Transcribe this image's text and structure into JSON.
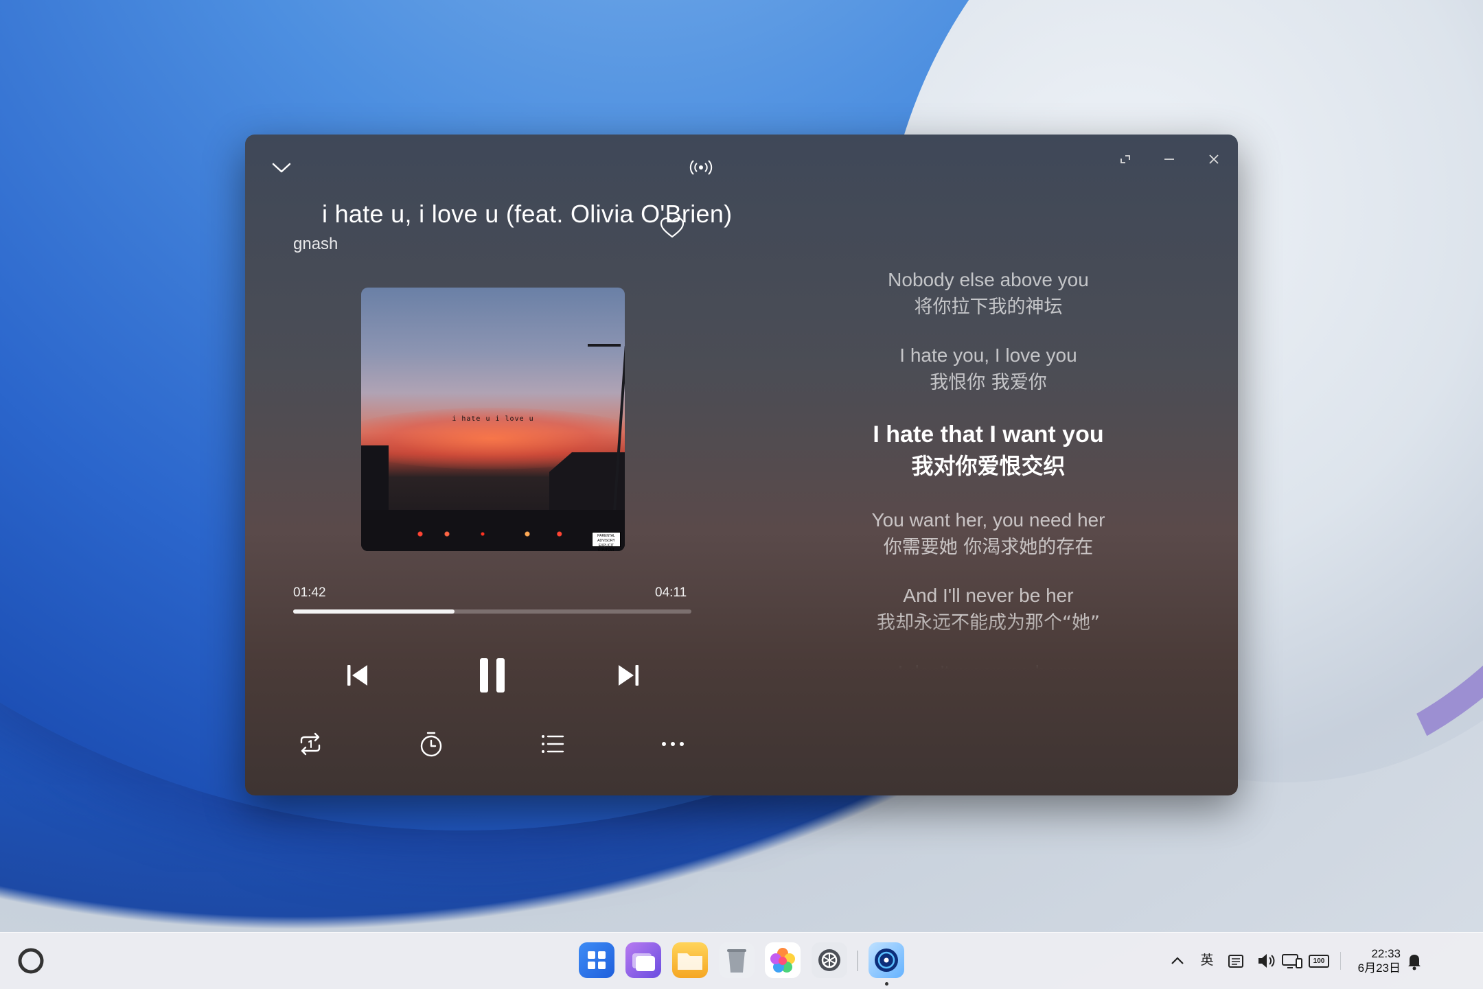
{
  "player": {
    "song_title": "i hate u, i love u (feat. Olivia O'Brien)",
    "artist": "gnash",
    "cover_text": "i hate u i love u",
    "advisory_text": "PARENTAL ADVISORY EXPLICIT CONTENT",
    "current_time": "01:42",
    "total_time": "04:11",
    "progress_fraction": 0.406
  },
  "lyrics": [
    {
      "en": "Nobody else above you",
      "zh": "将你拉下我的神坛",
      "active": false
    },
    {
      "en": "I hate you, I love you",
      "zh": "我恨你 我爱你",
      "active": false
    },
    {
      "en": "I hate that I want you",
      "zh": "我对你爱恨交织",
      "active": true
    },
    {
      "en": "You want her, you need her",
      "zh": "你需要她 你渴求她的存在",
      "active": false
    },
    {
      "en": "And I'll never be her",
      "zh": "我却永远不能成为那个“她”",
      "active": false
    },
    {
      "en": "I don't mean no harm",
      "zh": "",
      "active": false
    }
  ],
  "taskbar": {
    "apps": [
      "app-center-icon",
      "multitask-icon",
      "files-icon",
      "trash-icon",
      "gallery-icon",
      "settings-icon",
      "music-icon"
    ],
    "tray": {
      "ime_label": "英",
      "battery_label": "100"
    },
    "clock_time": "22:33",
    "clock_date": "6月23日"
  },
  "colors": {
    "accent_blue": "#2a6fe0",
    "progress_fill": "#f4f4f4"
  }
}
